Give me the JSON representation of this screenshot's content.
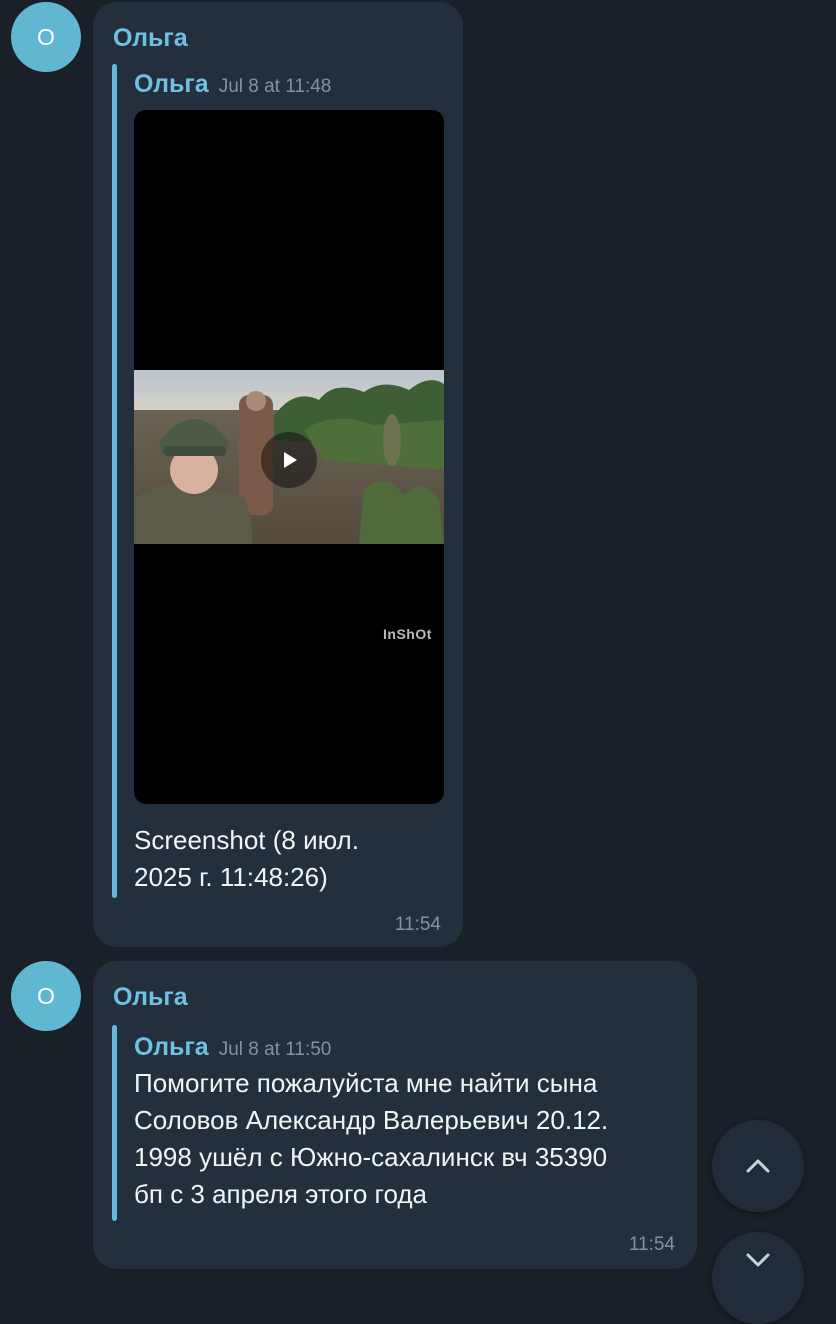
{
  "messages": [
    {
      "avatar_letter": "О",
      "sender": "Ольга",
      "forward": {
        "name": "Ольга",
        "date": "Jul 8 at 11:48"
      },
      "video": {
        "watermark": "InShOt",
        "icon": "play-icon"
      },
      "caption_line1": "Screenshot (8 июл.",
      "caption_line2": "2025 г. 11:48:26)",
      "time": "11:54"
    },
    {
      "avatar_letter": "О",
      "sender": "Ольга",
      "forward": {
        "name": "Ольга",
        "date": "Jul 8 at 11:50"
      },
      "text_lines": [
        "Помогите пожалуйста мне найти сына",
        "Соловов Александр Валерьевич 20.12.",
        "1998 ушёл с Южно-сахалинск вч 35390",
        "бп с 3 апреля этого года"
      ],
      "time": "11:54"
    }
  ],
  "fab": {
    "up_icon": "chevron-up-icon",
    "down_icon": "chevron-down-icon"
  },
  "colors": {
    "background": "#1a2028",
    "bubble": "#242f3d",
    "accent": "#6fc1e1",
    "avatar": "#5fb7d2"
  }
}
